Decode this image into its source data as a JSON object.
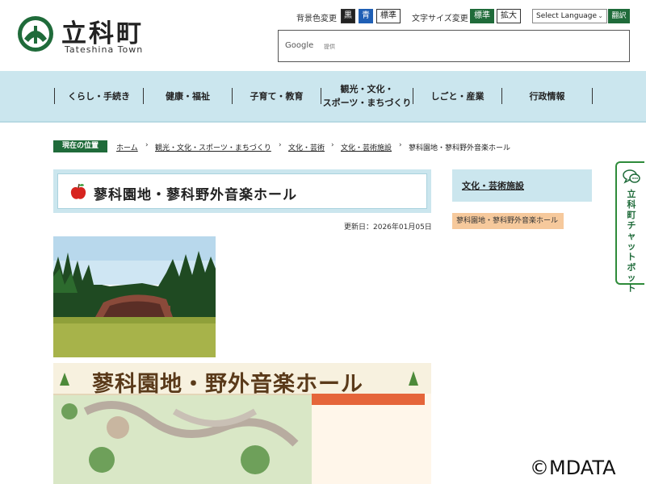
{
  "header": {
    "logo_title": "立科町",
    "logo_subtitle": "Tateshina Town",
    "bg_color_label": "背景色変更",
    "bg_black": "黒",
    "bg_blue": "青",
    "bg_standard": "標準",
    "font_size_label": "文字サイズ変更",
    "font_standard": "標準",
    "font_large": "拡大",
    "language_select": "Select Language",
    "translate_button": "翻訳",
    "search_brand": "Google",
    "search_brand_sub": "提供"
  },
  "nav": {
    "items": [
      {
        "label": "くらし・手続き"
      },
      {
        "label": "健康・福祉"
      },
      {
        "label": "子育て・教育"
      },
      {
        "label": "観光・文化・\nスポーツ・まちづくり"
      },
      {
        "label": "しごと・産業"
      },
      {
        "label": "行政情報"
      }
    ]
  },
  "breadcrumb": {
    "label": "現在の位置",
    "items": [
      "ホーム",
      "観光・文化・スポーツ・まちづくり",
      "文化・芸術",
      "文化・芸術施設",
      "蓼科園地・蓼科野外音楽ホール"
    ]
  },
  "main": {
    "title": "蓼科園地・蓼科野外音楽ホール",
    "updated": "更新日：2026年01月05日",
    "map_title": "蓼科園地・野外音楽ホール"
  },
  "sidebar": {
    "heading": "文化・芸術施設",
    "item": "蓼科園地・蓼科野外音楽ホール"
  },
  "chatbot": {
    "label": "立科町チャットボット"
  },
  "watermark": "©MDATA",
  "colors": {
    "brand_green": "#1f6b3a",
    "nav_bg": "#cbe6ee",
    "sidebar_item_bg": "#f6c99c",
    "chatbot_border": "#2e8b3a"
  }
}
